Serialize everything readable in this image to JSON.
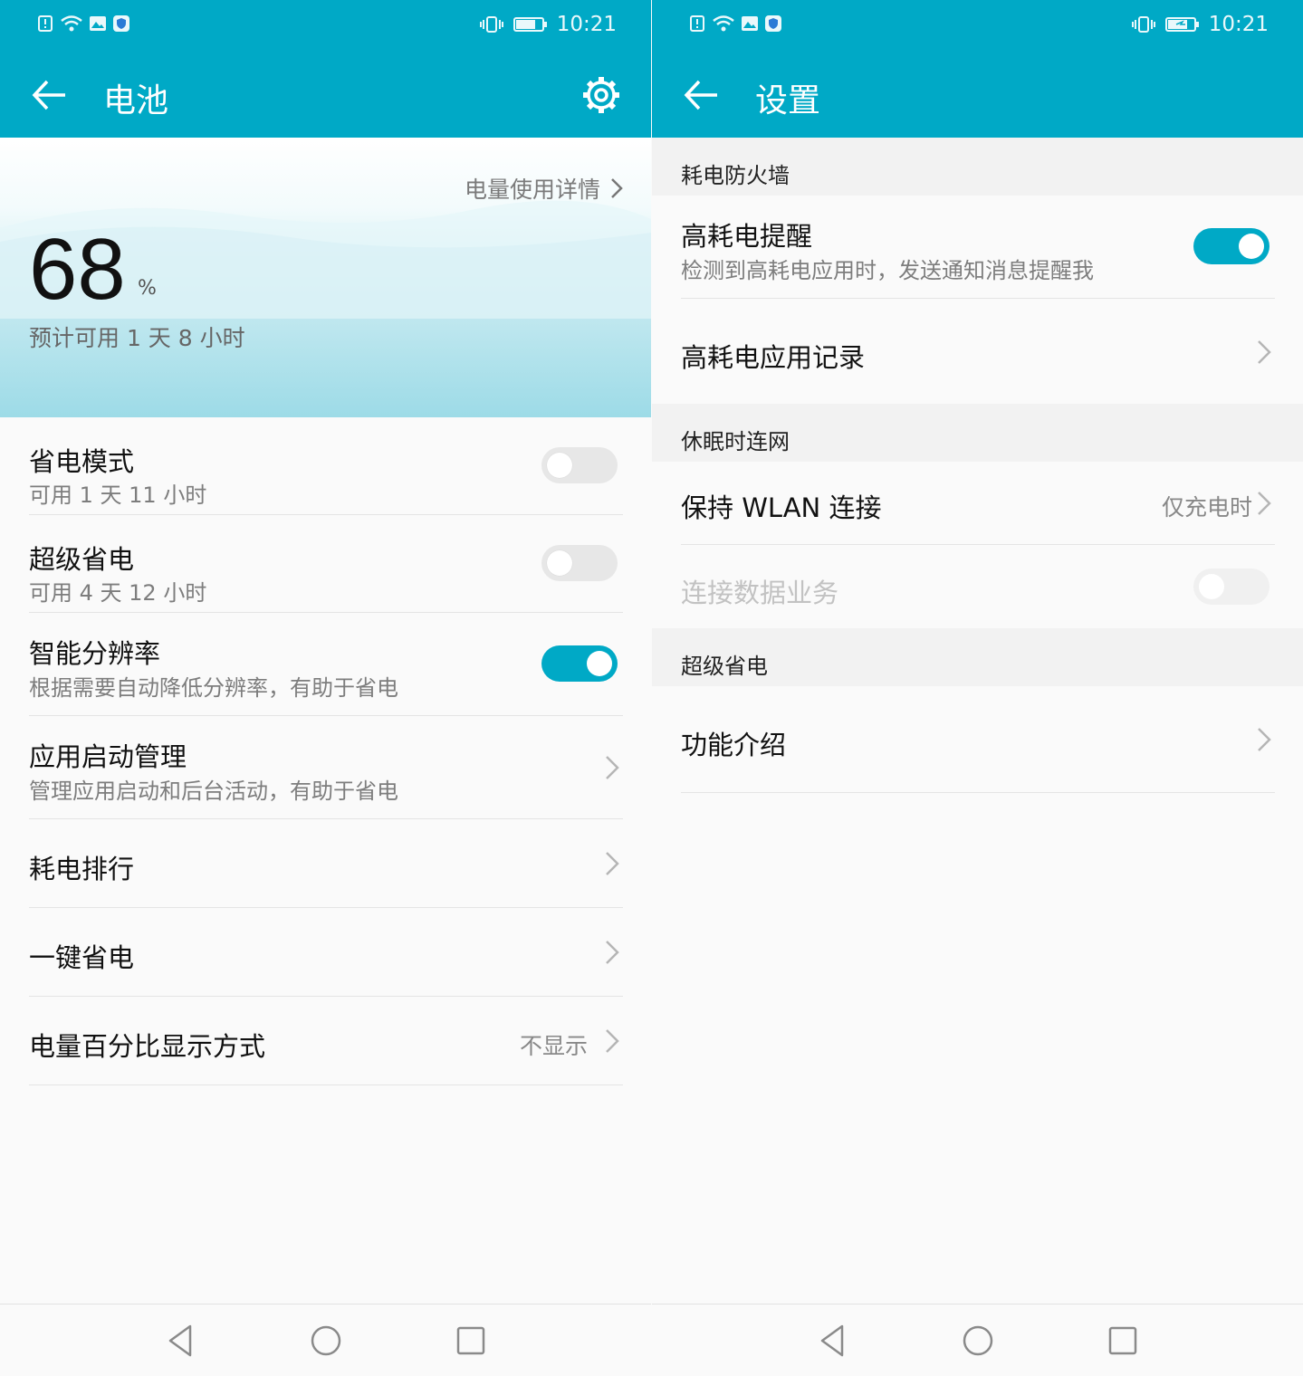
{
  "left_screen": {
    "status_bar": {
      "time": "10:21"
    },
    "title": "电池",
    "usage_link": "电量使用详情",
    "battery": {
      "level": "68",
      "unit": "%",
      "estimate": "预计可用 1 天 8 小时"
    },
    "items": [
      {
        "title": "省电模式",
        "subtitle": "可用 1 天 11 小时",
        "toggle": "off"
      },
      {
        "title": "超级省电",
        "subtitle": "可用 4 天 12 小时",
        "toggle": "off"
      },
      {
        "title": "智能分辨率",
        "subtitle": "根据需要自动降低分辨率，有助于省电",
        "toggle": "on"
      },
      {
        "title": "应用启动管理",
        "subtitle": "管理应用启动和后台活动，有助于省电"
      },
      {
        "title": "耗电排行"
      },
      {
        "title": "一键省电"
      },
      {
        "title": "电量百分比显示方式",
        "value": "不显示"
      }
    ]
  },
  "right_screen": {
    "status_bar": {
      "time": "10:21"
    },
    "title": "设置",
    "sections": [
      {
        "header": "耗电防火墙",
        "items": [
          {
            "title": "高耗电提醒",
            "subtitle": "检测到高耗电应用时，发送通知消息提醒我",
            "toggle": "on"
          },
          {
            "title": "高耗电应用记录"
          }
        ]
      },
      {
        "header": "休眠时连网",
        "items": [
          {
            "title": "保持 WLAN 连接",
            "value": "仅充电时"
          },
          {
            "title": "连接数据业务",
            "toggle": "off",
            "disabled": true
          }
        ]
      },
      {
        "header": "超级省电",
        "items": [
          {
            "title": "功能介绍"
          }
        ]
      }
    ]
  },
  "colors": {
    "accent": "#00a9c6",
    "background": "#fafafa"
  },
  "icons": [
    "sim-alert-icon",
    "wifi-icon",
    "gallery-icon",
    "shield-app-icon",
    "vibrate-icon",
    "battery-icon",
    "back-arrow-icon",
    "settings-gear-icon",
    "chevron-right-icon",
    "nav-back-icon",
    "nav-home-icon",
    "nav-recents-icon"
  ]
}
